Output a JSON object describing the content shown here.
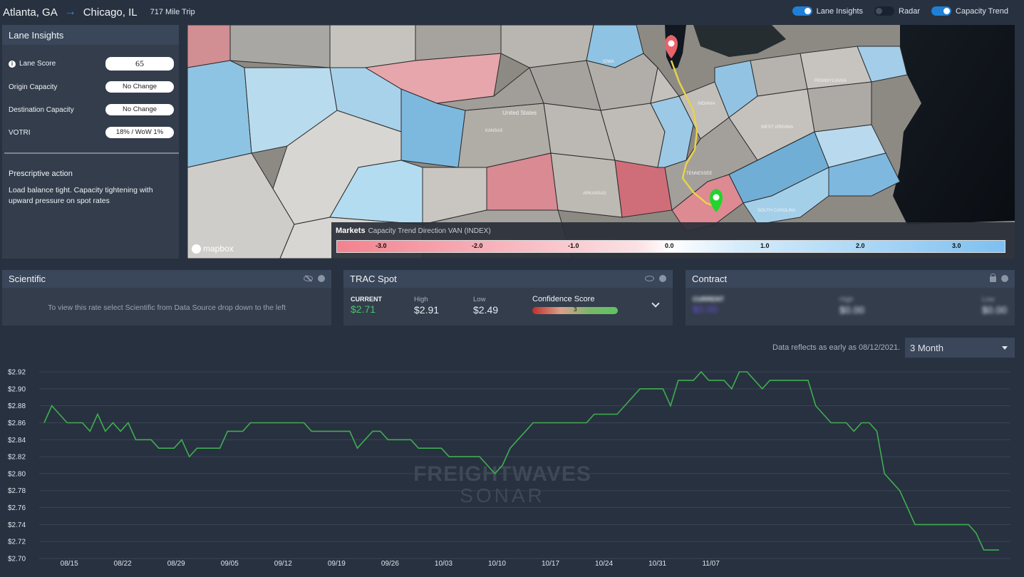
{
  "header": {
    "origin": "Atlanta, GA",
    "destination": "Chicago, IL",
    "trip": "717 Mile Trip",
    "toggles": [
      {
        "label": "Lane Insights",
        "on": true
      },
      {
        "label": "Radar",
        "on": false
      },
      {
        "label": "Capacity Trend",
        "on": true
      }
    ]
  },
  "lane_insights": {
    "title": "Lane Insights",
    "rows": [
      {
        "label": "Lane Score",
        "value": "65"
      },
      {
        "label": "Origin Capacity",
        "value": "No Change"
      },
      {
        "label": "Destination Capacity",
        "value": "No Change"
      },
      {
        "label": "VOTRI",
        "value": "18% / WoW 1%"
      }
    ],
    "prescriptive_title": "Prescriptive action",
    "prescriptive_text": "Load balance tight. Capacity tightening with upward pressure on spot rates"
  },
  "map": {
    "legend_title": "Markets",
    "legend_subtitle": "Capacity Trend Direction VAN (INDEX)",
    "legend_ticks": [
      "-3.0",
      "-2.0",
      "-1.0",
      "0.0",
      "1.0",
      "2.0",
      "3.0"
    ],
    "attribution": "mapbox",
    "labels": [
      "United States",
      "KANSAS",
      "ARKANSAS",
      "IOWA",
      "INDIANA",
      "TENNESSEE",
      "SOUTH CAROLINA",
      "PENNSYLVANIA",
      "WEST VIRGINIA"
    ]
  },
  "scientific": {
    "title": "Scientific",
    "message": "To view this rate select Scientific from Data Source drop down to the left"
  },
  "trac": {
    "title": "TRAC Spot",
    "current_label": "CURRENT",
    "current": "$2.71",
    "high_label": "High",
    "high": "$2.91",
    "low_label": "Low",
    "low": "$2.49",
    "confidence_label": "Confidence Score",
    "confidence": "3"
  },
  "contract": {
    "title": "Contract",
    "current_label": "CURRENT",
    "current": "$0.00",
    "high_label": "High",
    "high": "$0.00",
    "low_label": "Low",
    "low": "$0.00"
  },
  "range": {
    "note": "Data reflects as early as 08/12/2021.",
    "selected": "3 Month"
  },
  "watermark": {
    "line1": "FREIGHTWAVES",
    "line2": "SONAR"
  },
  "colors": {
    "line": "#3fae4f",
    "accent": "#1f7fd6",
    "origin_pin": "#22d42c",
    "dest_pin": "#e8626a",
    "route": "#e8d24a"
  },
  "chart_data": {
    "type": "line",
    "ylim": [
      2.7,
      2.92
    ],
    "yticks": [
      "$2.92",
      "$2.90",
      "$2.88",
      "$2.86",
      "$2.84",
      "$2.82",
      "$2.80",
      "$2.78",
      "$2.76",
      "$2.74",
      "$2.72",
      "$2.70"
    ],
    "xticks": [
      "08/15",
      "08/22",
      "08/29",
      "09/05",
      "09/12",
      "09/19",
      "09/26",
      "10/03",
      "10/10",
      "10/17",
      "10/24",
      "10/31",
      "11/07"
    ],
    "x_start": "08/12/2021",
    "series": [
      {
        "values": [
          2.86,
          2.88,
          2.87,
          2.86,
          2.86,
          2.86,
          2.85,
          2.87,
          2.85,
          2.86,
          2.85,
          2.86,
          2.84,
          2.84,
          2.84,
          2.83,
          2.83,
          2.83,
          2.84,
          2.82,
          2.83,
          2.83,
          2.83,
          2.83,
          2.85,
          2.85,
          2.85,
          2.86,
          2.86,
          2.86,
          2.86,
          2.86,
          2.86,
          2.86,
          2.86,
          2.85,
          2.85,
          2.85,
          2.85,
          2.85,
          2.85,
          2.83,
          2.84,
          2.85,
          2.85,
          2.84,
          2.84,
          2.84,
          2.84,
          2.83,
          2.83,
          2.83,
          2.83,
          2.82,
          2.82,
          2.82,
          2.82,
          2.82,
          2.81,
          2.8,
          2.81,
          2.83,
          2.84,
          2.85,
          2.86,
          2.86,
          2.86,
          2.86,
          2.86,
          2.86,
          2.86,
          2.86,
          2.87,
          2.87,
          2.87,
          2.87,
          2.88,
          2.89,
          2.9,
          2.9,
          2.9,
          2.9,
          2.88,
          2.91,
          2.91,
          2.91,
          2.92,
          2.91,
          2.91,
          2.91,
          2.9,
          2.92,
          2.92,
          2.91,
          2.9,
          2.91,
          2.91,
          2.91,
          2.91,
          2.91,
          2.91,
          2.88,
          2.87,
          2.86,
          2.86,
          2.86,
          2.85,
          2.86,
          2.86,
          2.85,
          2.8,
          2.79,
          2.78,
          2.76,
          2.74,
          2.74,
          2.74,
          2.74,
          2.74,
          2.74,
          2.74,
          2.74,
          2.73,
          2.71,
          2.71,
          2.71
        ]
      }
    ]
  }
}
